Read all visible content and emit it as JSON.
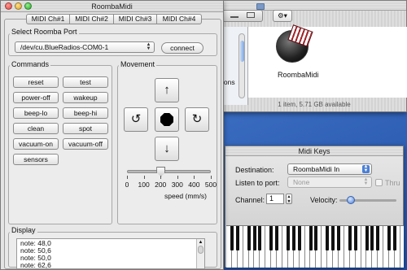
{
  "main_window": {
    "title": "RoombaMidi",
    "tabs": [
      {
        "label": "MIDI Ch#1",
        "selected": true
      },
      {
        "label": "MIDI Ch#2",
        "selected": false
      },
      {
        "label": "MIDI Ch#3",
        "selected": false
      },
      {
        "label": "MIDI Ch#4",
        "selected": false
      }
    ],
    "port_group": {
      "label": "Select Roomba Port",
      "selected_port": "/dev/cu.BlueRadios-COM0-1",
      "connect_label": "connect"
    },
    "commands": {
      "label": "Commands",
      "buttons": [
        "reset",
        "test",
        "power-off",
        "wakeup",
        "beep-lo",
        "beep-hi",
        "clean",
        "spot",
        "vacuum-on",
        "vacuum-off",
        "sensors"
      ]
    },
    "movement": {
      "label": "Movement",
      "up": "↑",
      "down": "↓",
      "left": "↺",
      "right": "↻",
      "stop_icon": "octagon-stop",
      "slider_ticks": [
        "0",
        "100",
        "200",
        "300",
        "400",
        "500"
      ],
      "slider_value": 200,
      "slider_max": 500,
      "slider_label": "speed (mm/s)"
    },
    "display": {
      "label": "Display",
      "lines": [
        "note: 48,0",
        "note: 50,6",
        "note: 50,0",
        "note: 62,6",
        "note: 62,0"
      ]
    }
  },
  "finder_window": {
    "sidebar_partial": [
      "ions"
    ],
    "item_label": "RoombaMidi",
    "status": "1 item, 5.71 GB available"
  },
  "midi_keys": {
    "title": "Midi Keys",
    "destination_label": "Destination:",
    "destination_value": "RoombaMidi In",
    "listen_label": "Listen to port:",
    "listen_value": "None",
    "thru_label": "Thru",
    "channel_label": "Channel:",
    "channel_value": "1",
    "velocity_label": "Velocity:",
    "velocity_fraction": 0.2
  },
  "colors": {
    "desktop": "#3a6cc0",
    "close": "#e0443e",
    "minimize": "#dea123",
    "zoom": "#1aab29",
    "popup_blue": "#4a7fd6"
  }
}
